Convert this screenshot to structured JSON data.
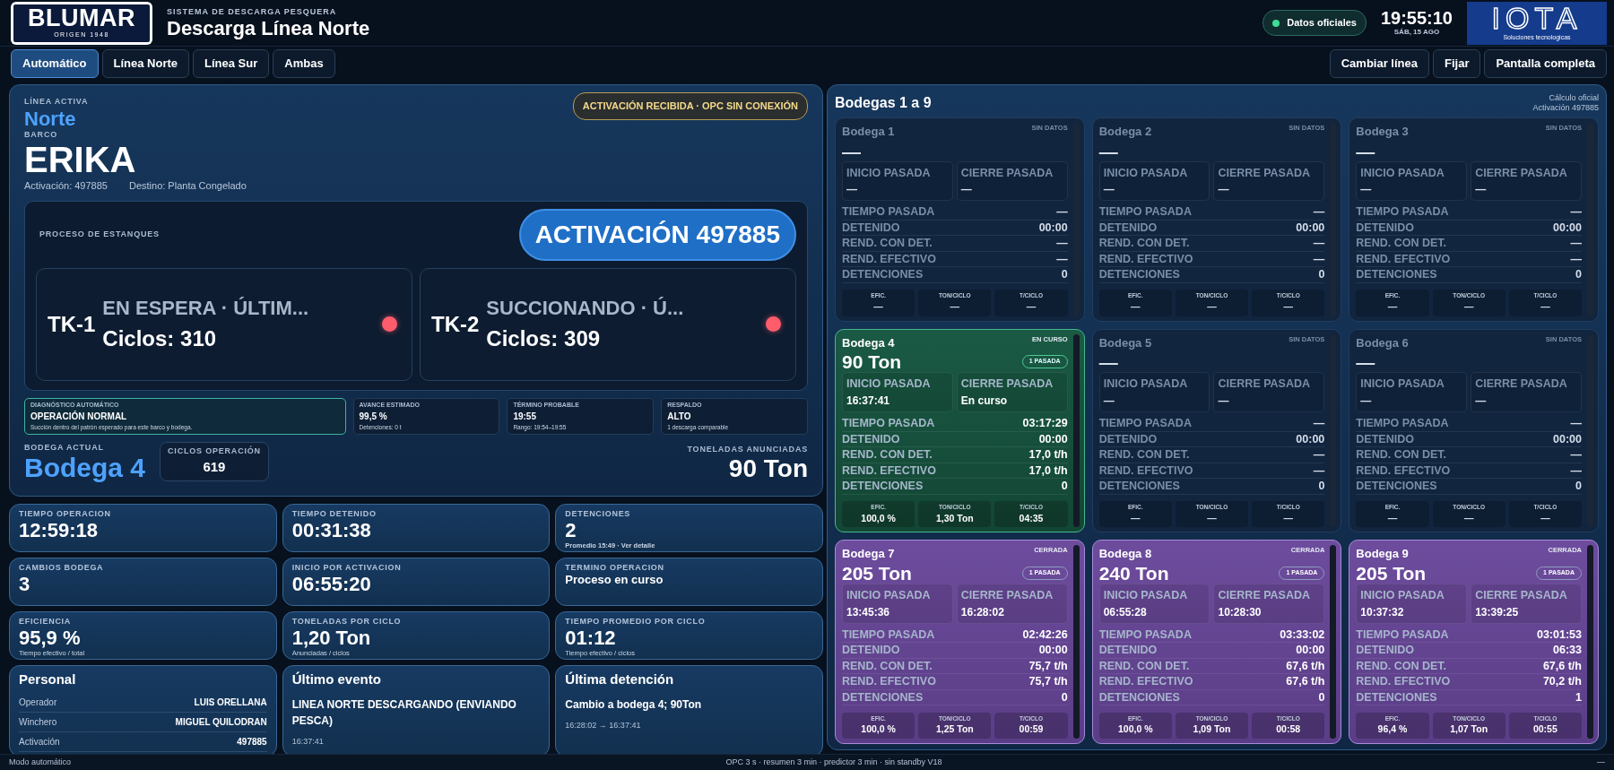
{
  "header": {
    "logo": {
      "name": "BLUMAR",
      "tagline": "ORIGEN 1948"
    },
    "subtitle": "SISTEMA DE DESCARGA PESQUERA",
    "title": "Descarga Línea Norte",
    "source": "Datos oficiales",
    "time": "19:55:10",
    "date": "SÁB, 15 AGO",
    "partner_logo": {
      "name": "IOTA",
      "tagline": "Soluciones tecnologicas"
    }
  },
  "tabs": [
    {
      "label": "Automático",
      "selected": true
    },
    {
      "label": "Línea Norte",
      "selected": false
    },
    {
      "label": "Línea Sur",
      "selected": false
    },
    {
      "label": "Ambas",
      "selected": false
    }
  ],
  "actions": [
    "Cambiar línea",
    "Fijar",
    "Pantalla completa"
  ],
  "hero": {
    "line_label": "LÍNEA ACTIVA",
    "line": "Norte",
    "ship_label": "BARCO",
    "ship": "ERIKA",
    "activation": "Activación: 497885",
    "destination": "Destino: Planta Congelado",
    "alert": "ACTIVACIÓN RECIBIDA · OPC SIN CONEXIÓN"
  },
  "process": {
    "title": "PROCESO DE ESTANQUES",
    "pill": "ACTIVACIÓN 497885",
    "tanks": [
      {
        "id": "TK-1",
        "status": "EN ESPERA · ÚLTIM...",
        "cycles": "Ciclos: 310",
        "color": "#ff5c6c"
      },
      {
        "id": "TK-2",
        "status": "SUCCIONANDO · Ú...",
        "cycles": "Ciclos: 309",
        "color": "#ff5c6c"
      }
    ]
  },
  "diagnostics": [
    {
      "title": "DIAGNÓSTICO AUTOMÁTICO",
      "value": "OPERACIÓN NORMAL",
      "note": "Succión dentro del patrón esperado para este barco y bodega.",
      "highlighted": true
    },
    {
      "title": "AVANCE ESTIMADO",
      "value": "99,5 %",
      "note": "Detenciones: 0 t",
      "highlighted": false
    },
    {
      "title": "TÉRMINO PROBABLE",
      "value": "19:55",
      "note": "Rango: 19:54–19:55",
      "highlighted": false
    },
    {
      "title": "RESPALDO",
      "value": "ALTO",
      "note": "1 descarga comparable",
      "highlighted": false
    }
  ],
  "current_hold": {
    "label": "BODEGA ACTUAL",
    "value": "Bodega 4",
    "cycles_label": "CICLOS OPERACIÓN",
    "cycles": "619",
    "tons_label": "TONELADAS ANUNCIADAS",
    "tons": "90 Ton"
  },
  "stats": [
    {
      "kind": "number",
      "label": "TIEMPO OPERACION",
      "value": "12:59:18"
    },
    {
      "kind": "number",
      "label": "TIEMPO DETENIDO",
      "value": "00:31:38"
    },
    {
      "kind": "number",
      "label": "DETENCIONES",
      "value": "2",
      "note": "Promedio 15:49 · Ver detalle"
    },
    {
      "kind": "number",
      "label": "CAMBIOS BODEGA",
      "value": "3"
    },
    {
      "kind": "number",
      "label": "INICIO POR ACTIVACION",
      "value": "06:55:20"
    },
    {
      "kind": "text",
      "label": "TERMINO OPERACION",
      "value": "Proceso en curso"
    },
    {
      "kind": "number",
      "label": "EFICIENCIA",
      "value": "95,9 %",
      "note": "Tiempo efectivo / total"
    },
    {
      "kind": "number",
      "label": "TONELADAS POR CICLO",
      "value": "1,20 Ton",
      "note": "Anunciadas / ciclos"
    },
    {
      "kind": "number",
      "label": "TIEMPO PROMEDIO POR CICLO",
      "value": "01:12",
      "note": "Tiempo efectivo / ciclos"
    }
  ],
  "personal": {
    "title": "Personal",
    "rows": [
      {
        "label": "Operador",
        "value": "LUIS ORELLANA"
      },
      {
        "label": "Winchero",
        "value": "MIGUEL QUILODRAN"
      },
      {
        "label": "Activación",
        "value": "497885"
      }
    ]
  },
  "last_event": {
    "title": "Último evento",
    "text": "LINEA NORTE DESCARGANDO (ENVIANDO PESCA)",
    "time": "16:37:41"
  },
  "last_stop": {
    "title": "Última detención",
    "text": "Cambio a bodega 4; 90Ton",
    "time": "16:28:02 → 16:37:41"
  },
  "holds": {
    "title": "Bodegas 1 a 9",
    "notes": [
      "Cálculo oficial",
      "Activación 497885"
    ],
    "items": [
      {
        "name": "Bodega 1",
        "kind": "empty",
        "status_label": "SIN DATOS",
        "tons": "—",
        "start": {
          "label": "INICIO PASADA",
          "value": "—"
        },
        "end": {
          "label": "CIERRE PASADA",
          "value": "—"
        },
        "rows": [
          {
            "label": "TIEMPO PASADA",
            "value": "—"
          },
          {
            "label": "DETENIDO",
            "value": "00:00"
          },
          {
            "label": "REND. CON DET.",
            "value": "—"
          },
          {
            "label": "REND. EFECTIVO",
            "value": "—"
          },
          {
            "label": "DETENCIONES",
            "value": "0"
          }
        ],
        "metrics": [
          {
            "label": "EFIC.",
            "value": "—"
          },
          {
            "label": "TON/CICLO",
            "value": "—"
          },
          {
            "label": "T/CICLO",
            "value": "—"
          }
        ]
      },
      {
        "name": "Bodega 2",
        "kind": "empty",
        "status_label": "SIN DATOS",
        "tons": "—",
        "start": {
          "label": "INICIO PASADA",
          "value": "—"
        },
        "end": {
          "label": "CIERRE PASADA",
          "value": "—"
        },
        "rows": [
          {
            "label": "TIEMPO PASADA",
            "value": "—"
          },
          {
            "label": "DETENIDO",
            "value": "00:00"
          },
          {
            "label": "REND. CON DET.",
            "value": "—"
          },
          {
            "label": "REND. EFECTIVO",
            "value": "—"
          },
          {
            "label": "DETENCIONES",
            "value": "0"
          }
        ],
        "metrics": [
          {
            "label": "EFIC.",
            "value": "—"
          },
          {
            "label": "TON/CICLO",
            "value": "—"
          },
          {
            "label": "T/CICLO",
            "value": "—"
          }
        ]
      },
      {
        "name": "Bodega 3",
        "kind": "empty",
        "status_label": "SIN DATOS",
        "tons": "—",
        "start": {
          "label": "INICIO PASADA",
          "value": "—"
        },
        "end": {
          "label": "CIERRE PASADA",
          "value": "—"
        },
        "rows": [
          {
            "label": "TIEMPO PASADA",
            "value": "—"
          },
          {
            "label": "DETENIDO",
            "value": "00:00"
          },
          {
            "label": "REND. CON DET.",
            "value": "—"
          },
          {
            "label": "REND. EFECTIVO",
            "value": "—"
          },
          {
            "label": "DETENCIONES",
            "value": "0"
          }
        ],
        "metrics": [
          {
            "label": "EFIC.",
            "value": "—"
          },
          {
            "label": "TON/CICLO",
            "value": "—"
          },
          {
            "label": "T/CICLO",
            "value": "—"
          }
        ]
      },
      {
        "name": "Bodega 4",
        "kind": "active",
        "status_label": "EN CURSO",
        "tons": "90 Ton",
        "passes": "1 PASADA",
        "start": {
          "label": "INICIO PASADA",
          "value": "16:37:41"
        },
        "end": {
          "label": "CIERRE PASADA",
          "value": "En curso"
        },
        "rows": [
          {
            "label": "TIEMPO PASADA",
            "value": "03:17:29"
          },
          {
            "label": "DETENIDO",
            "value": "00:00"
          },
          {
            "label": "REND. CON DET.",
            "value": "17,0 t/h"
          },
          {
            "label": "REND. EFECTIVO",
            "value": "17,0 t/h"
          },
          {
            "label": "DETENCIONES",
            "value": "0"
          }
        ],
        "metrics": [
          {
            "label": "EFIC.",
            "value": "100,0 %"
          },
          {
            "label": "TON/CICLO",
            "value": "1,30 Ton"
          },
          {
            "label": "T/CICLO",
            "value": "04:35"
          }
        ]
      },
      {
        "name": "Bodega 5",
        "kind": "empty",
        "status_label": "SIN DATOS",
        "tons": "—",
        "start": {
          "label": "INICIO PASADA",
          "value": "—"
        },
        "end": {
          "label": "CIERRE PASADA",
          "value": "—"
        },
        "rows": [
          {
            "label": "TIEMPO PASADA",
            "value": "—"
          },
          {
            "label": "DETENIDO",
            "value": "00:00"
          },
          {
            "label": "REND. CON DET.",
            "value": "—"
          },
          {
            "label": "REND. EFECTIVO",
            "value": "—"
          },
          {
            "label": "DETENCIONES",
            "value": "0"
          }
        ],
        "metrics": [
          {
            "label": "EFIC.",
            "value": "—"
          },
          {
            "label": "TON/CICLO",
            "value": "—"
          },
          {
            "label": "T/CICLO",
            "value": "—"
          }
        ]
      },
      {
        "name": "Bodega 6",
        "kind": "empty",
        "status_label": "SIN DATOS",
        "tons": "—",
        "start": {
          "label": "INICIO PASADA",
          "value": "—"
        },
        "end": {
          "label": "CIERRE PASADA",
          "value": "—"
        },
        "rows": [
          {
            "label": "TIEMPO PASADA",
            "value": "—"
          },
          {
            "label": "DETENIDO",
            "value": "00:00"
          },
          {
            "label": "REND. CON DET.",
            "value": "—"
          },
          {
            "label": "REND. EFECTIVO",
            "value": "—"
          },
          {
            "label": "DETENCIONES",
            "value": "0"
          }
        ],
        "metrics": [
          {
            "label": "EFIC.",
            "value": "—"
          },
          {
            "label": "TON/CICLO",
            "value": "—"
          },
          {
            "label": "T/CICLO",
            "value": "—"
          }
        ]
      },
      {
        "name": "Bodega 7",
        "kind": "closed",
        "status_label": "CERRADA",
        "tons": "205 Ton",
        "passes": "1 PASADA",
        "start": {
          "label": "INICIO PASADA",
          "value": "13:45:36"
        },
        "end": {
          "label": "CIERRE PASADA",
          "value": "16:28:02"
        },
        "rows": [
          {
            "label": "TIEMPO PASADA",
            "value": "02:42:26"
          },
          {
            "label": "DETENIDO",
            "value": "00:00"
          },
          {
            "label": "REND. CON DET.",
            "value": "75,7 t/h"
          },
          {
            "label": "REND. EFECTIVO",
            "value": "75,7 t/h"
          },
          {
            "label": "DETENCIONES",
            "value": "0"
          }
        ],
        "metrics": [
          {
            "label": "EFIC.",
            "value": "100,0 %"
          },
          {
            "label": "TON/CICLO",
            "value": "1,25 Ton"
          },
          {
            "label": "T/CICLO",
            "value": "00:59"
          }
        ]
      },
      {
        "name": "Bodega 8",
        "kind": "closed",
        "status_label": "CERRADA",
        "tons": "240 Ton",
        "passes": "1 PASADA",
        "start": {
          "label": "INICIO PASADA",
          "value": "06:55:28"
        },
        "end": {
          "label": "CIERRE PASADA",
          "value": "10:28:30"
        },
        "rows": [
          {
            "label": "TIEMPO PASADA",
            "value": "03:33:02"
          },
          {
            "label": "DETENIDO",
            "value": "00:00"
          },
          {
            "label": "REND. CON DET.",
            "value": "67,6 t/h"
          },
          {
            "label": "REND. EFECTIVO",
            "value": "67,6 t/h"
          },
          {
            "label": "DETENCIONES",
            "value": "0"
          }
        ],
        "metrics": [
          {
            "label": "EFIC.",
            "value": "100,0 %"
          },
          {
            "label": "TON/CICLO",
            "value": "1,09 Ton"
          },
          {
            "label": "T/CICLO",
            "value": "00:58"
          }
        ]
      },
      {
        "name": "Bodega 9",
        "kind": "closed",
        "status_label": "CERRADA",
        "tons": "205 Ton",
        "passes": "1 PASADA",
        "start": {
          "label": "INICIO PASADA",
          "value": "10:37:32"
        },
        "end": {
          "label": "CIERRE PASADA",
          "value": "13:39:25"
        },
        "rows": [
          {
            "label": "TIEMPO PASADA",
            "value": "03:01:53"
          },
          {
            "label": "DETENIDO",
            "value": "06:33"
          },
          {
            "label": "REND. CON DET.",
            "value": "67,6 t/h"
          },
          {
            "label": "REND. EFECTIVO",
            "value": "70,2 t/h"
          },
          {
            "label": "DETENCIONES",
            "value": "1"
          }
        ],
        "metrics": [
          {
            "label": "EFIC.",
            "value": "96,4 %"
          },
          {
            "label": "TON/CICLO",
            "value": "1,07 Ton"
          },
          {
            "label": "T/CICLO",
            "value": "00:55"
          }
        ]
      }
    ]
  },
  "status_bar": {
    "mode": "Modo automático",
    "timers": "OPC 3 s · resumen 3 min · predictor 3 min · sin standby V18",
    "right": "—"
  }
}
